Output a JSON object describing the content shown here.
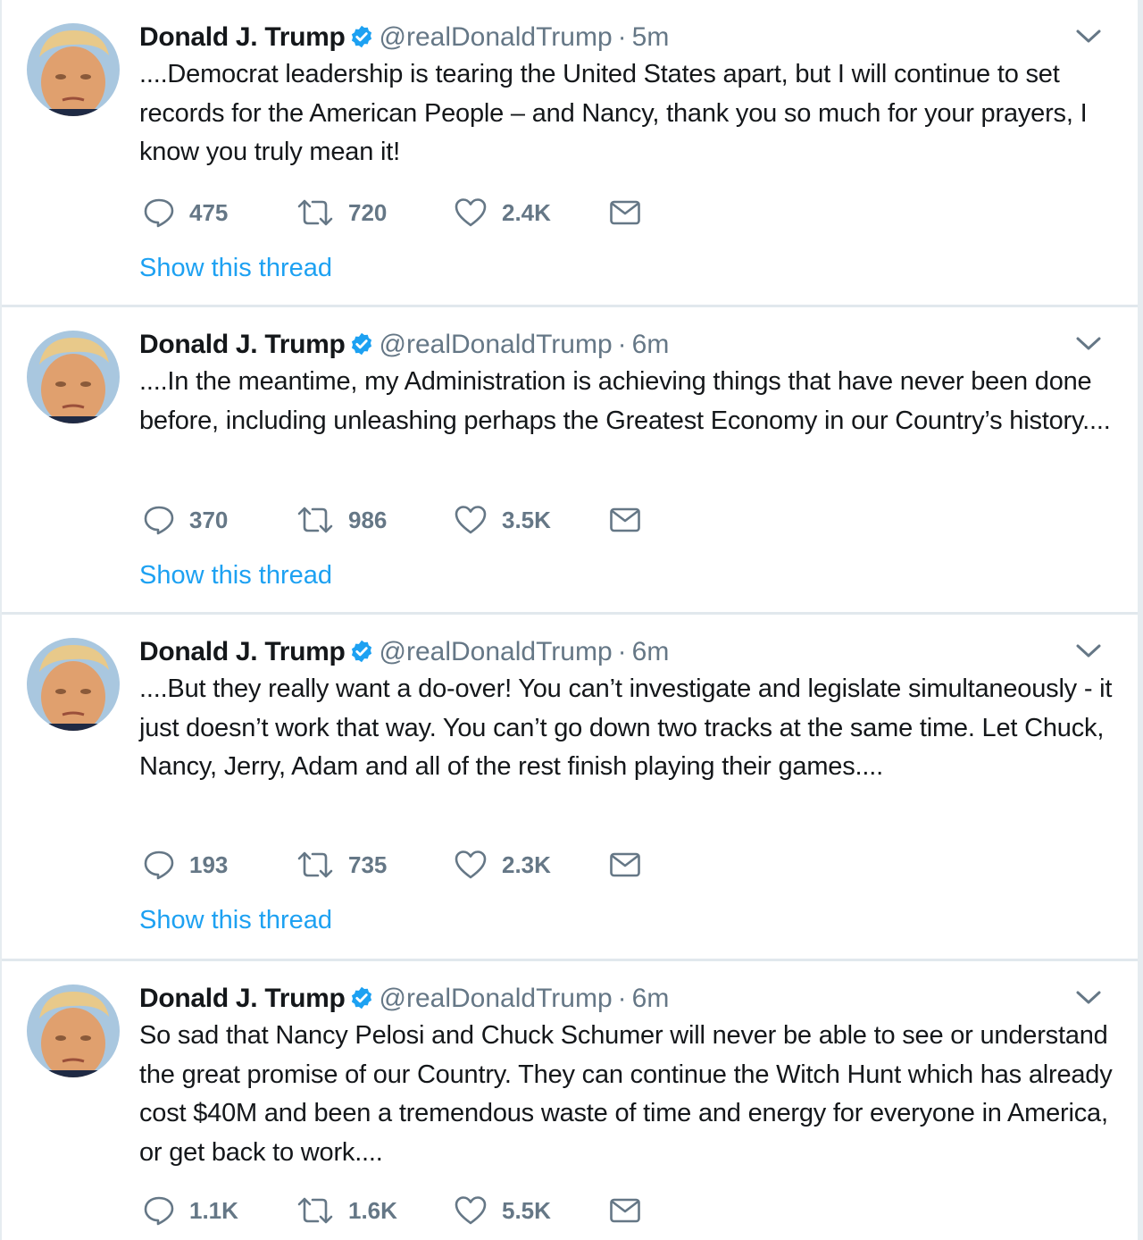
{
  "colors": {
    "link": "#1da1f2",
    "muted": "#657786",
    "text": "#14171a",
    "verified": "#1da1f2"
  },
  "icons": {
    "verified": "verified-badge-icon",
    "caret": "chevron-down-icon",
    "reply": "reply-icon",
    "retweet": "retweet-icon",
    "like": "heart-icon",
    "dm": "envelope-icon"
  },
  "tweets": [
    {
      "name": "Donald J. Trump",
      "handle": "@realDonaldTrump",
      "sep": "·",
      "time": "5m",
      "text": "....Democrat leadership is tearing the United States apart, but I will continue to set records for the American People – and Nancy, thank you so much for your prayers, I know you truly mean it!",
      "replies": "475",
      "retweets": "720",
      "likes": "2.4K",
      "thread_link": "Show this thread"
    },
    {
      "name": "Donald J. Trump",
      "handle": "@realDonaldTrump",
      "sep": "·",
      "time": "6m",
      "text": "....In the meantime, my Administration is achieving things that have never been done before, including unleashing perhaps the Greatest Economy in our Country’s history....",
      "replies": "370",
      "retweets": "986",
      "likes": "3.5K",
      "thread_link": "Show this thread"
    },
    {
      "name": "Donald J. Trump",
      "handle": "@realDonaldTrump",
      "sep": "·",
      "time": "6m",
      "text": "....But they really want a do-over! You can’t investigate and legislate simultaneously - it just doesn’t work that way. You can’t go down two tracks at the same time. Let Chuck, Nancy, Jerry, Adam and all of the rest finish playing their games....",
      "replies": "193",
      "retweets": "735",
      "likes": "2.3K",
      "thread_link": "Show this thread"
    },
    {
      "name": "Donald J. Trump",
      "handle": "@realDonaldTrump",
      "sep": "·",
      "time": "6m",
      "text": "So sad that Nancy Pelosi and Chuck Schumer will never be able to see or understand the great promise of our Country. They can continue the Witch Hunt which has already cost $40M and been a tremendous waste of time and energy for everyone in America, or get back to work....",
      "replies": "1.1K",
      "retweets": "1.6K",
      "likes": "5.5K"
    }
  ]
}
